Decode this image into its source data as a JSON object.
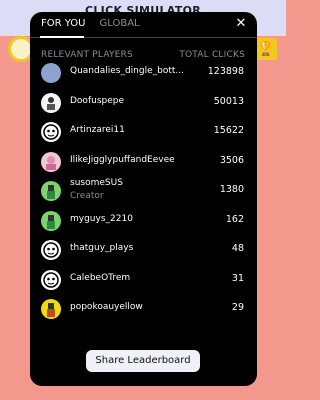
{
  "app": {
    "title": "CLICK SIMULATOR"
  },
  "tabs": [
    {
      "label": "FOR YOU",
      "active": true
    },
    {
      "label": "GLOBAL",
      "active": false
    }
  ],
  "columns": {
    "players": "RELEVANT PLAYERS",
    "clicks": "TOTAL CLICKS"
  },
  "players": [
    {
      "name": "Quandalies_dingle_bott...",
      "clicks": "123898",
      "subtitle": "",
      "avatar": "blue-circle-avatar"
    },
    {
      "name": "Doofuspepe",
      "clicks": "50013",
      "subtitle": "",
      "avatar": "character-avatar"
    },
    {
      "name": "Artinzarei11",
      "clicks": "15622",
      "subtitle": "",
      "avatar": "face-avatar"
    },
    {
      "name": "IlikeJigglypuffandEevee",
      "clicks": "3506",
      "subtitle": "",
      "avatar": "pink-avatar"
    },
    {
      "name": "susomeSUS",
      "clicks": "1380",
      "subtitle": "Creator",
      "avatar": "green-avatar"
    },
    {
      "name": "myguys_2210",
      "clicks": "162",
      "subtitle": "",
      "avatar": "green-avatar"
    },
    {
      "name": "thatguy_plays",
      "clicks": "48",
      "subtitle": "",
      "avatar": "face-avatar"
    },
    {
      "name": "CalebeOTrem",
      "clicks": "31",
      "subtitle": "",
      "avatar": "face-avatar"
    },
    {
      "name": "popokoauyellow",
      "clicks": "29",
      "subtitle": "",
      "avatar": "yellow-avatar"
    }
  ],
  "share_button": {
    "label": "Share Leaderboard"
  },
  "colors": {
    "background": "#f2988c",
    "panel": "#000000",
    "accent": "#f0c820"
  }
}
